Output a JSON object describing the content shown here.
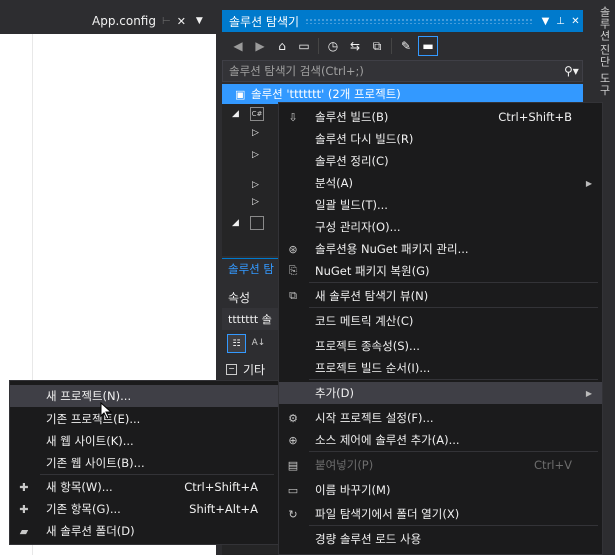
{
  "editor": {
    "tab_title": "App.config"
  },
  "solution_explorer": {
    "title": "솔루션 탐색기",
    "search_placeholder": "솔루션 탐색기 검색(Ctrl+;)",
    "solution_label": "솔루션 'ttttttt' (2개 프로젝트)",
    "bottom_tab": "솔루션 탐",
    "tree_rows": [
      "C#",
      "",
      "",
      "",
      "",
      "",
      ""
    ]
  },
  "properties": {
    "title": "속성",
    "object": "ttttttt 솔",
    "category": "기타"
  },
  "right_tabs": [
    "솔루션",
    "진단 도구"
  ],
  "main_menu": {
    "items": [
      {
        "label": "솔루션 빌드(B)",
        "shortcut": "Ctrl+Shift+B",
        "icon": "build-icon"
      },
      {
        "label": "솔루션 다시 빌드(R)",
        "shortcut": "",
        "icon": ""
      },
      {
        "label": "솔루션 정리(C)",
        "shortcut": "",
        "icon": ""
      },
      {
        "label": "분석(A)",
        "shortcut": "",
        "icon": "",
        "submenu": true
      },
      {
        "label": "일괄 빌드(T)...",
        "shortcut": "",
        "icon": ""
      },
      {
        "label": "구성 관리자(O)...",
        "shortcut": "",
        "icon": ""
      },
      {
        "label": "솔루션용 NuGet 패키지 관리...",
        "shortcut": "",
        "icon": "nuget-icon"
      },
      {
        "label": "NuGet 패키지 복원(G)",
        "shortcut": "",
        "icon": "restore-icon"
      },
      {
        "label": "새 솔루션 탐색기 뷰(N)",
        "shortcut": "",
        "icon": "new-view-icon"
      },
      {
        "label": "코드 메트릭 계산(C)",
        "shortcut": "",
        "icon": ""
      },
      {
        "label": "프로젝트 종속성(S)...",
        "shortcut": "",
        "icon": ""
      },
      {
        "label": "프로젝트 빌드 순서(I)...",
        "shortcut": "",
        "icon": ""
      },
      {
        "label": "추가(D)",
        "shortcut": "",
        "icon": "",
        "submenu": true
      },
      {
        "label": "시작 프로젝트 설정(F)...",
        "shortcut": "",
        "icon": "gear-icon"
      },
      {
        "label": "소스 제어에 솔루션 추가(A)...",
        "shortcut": "",
        "icon": "source-control-icon"
      },
      {
        "label": "붙여넣기(P)",
        "shortcut": "Ctrl+V",
        "icon": "paste-icon",
        "disabled": true
      },
      {
        "label": "이름 바꾸기(M)",
        "shortcut": "",
        "icon": "rename-icon"
      },
      {
        "label": "파일 탐색기에서 폴더 열기(X)",
        "shortcut": "",
        "icon": "refresh-icon"
      },
      {
        "label": "경량 솔루션 로드 사용",
        "shortcut": "",
        "icon": ""
      }
    ]
  },
  "sub_menu": {
    "items": [
      {
        "label": "새 프로젝트(N)...",
        "shortcut": "",
        "icon": ""
      },
      {
        "label": "기존 프로젝트(E)...",
        "shortcut": "",
        "icon": ""
      },
      {
        "label": "새 웹 사이트(K)...",
        "shortcut": "",
        "icon": ""
      },
      {
        "label": "기존 웹 사이트(B)...",
        "shortcut": "",
        "icon": ""
      },
      {
        "label": "새 항목(W)...",
        "shortcut": "Ctrl+Shift+A",
        "icon": "new-item-icon"
      },
      {
        "label": "기존 항목(G)...",
        "shortcut": "Shift+Alt+A",
        "icon": "existing-item-icon"
      },
      {
        "label": "새 솔루션 폴더(D)",
        "shortcut": "",
        "icon": "folder-icon"
      }
    ]
  },
  "colors": {
    "accent": "#007acc",
    "selection": "#3399ff",
    "menu_bg": "#1b1b1c",
    "menu_highlight": "#3f3f46"
  }
}
